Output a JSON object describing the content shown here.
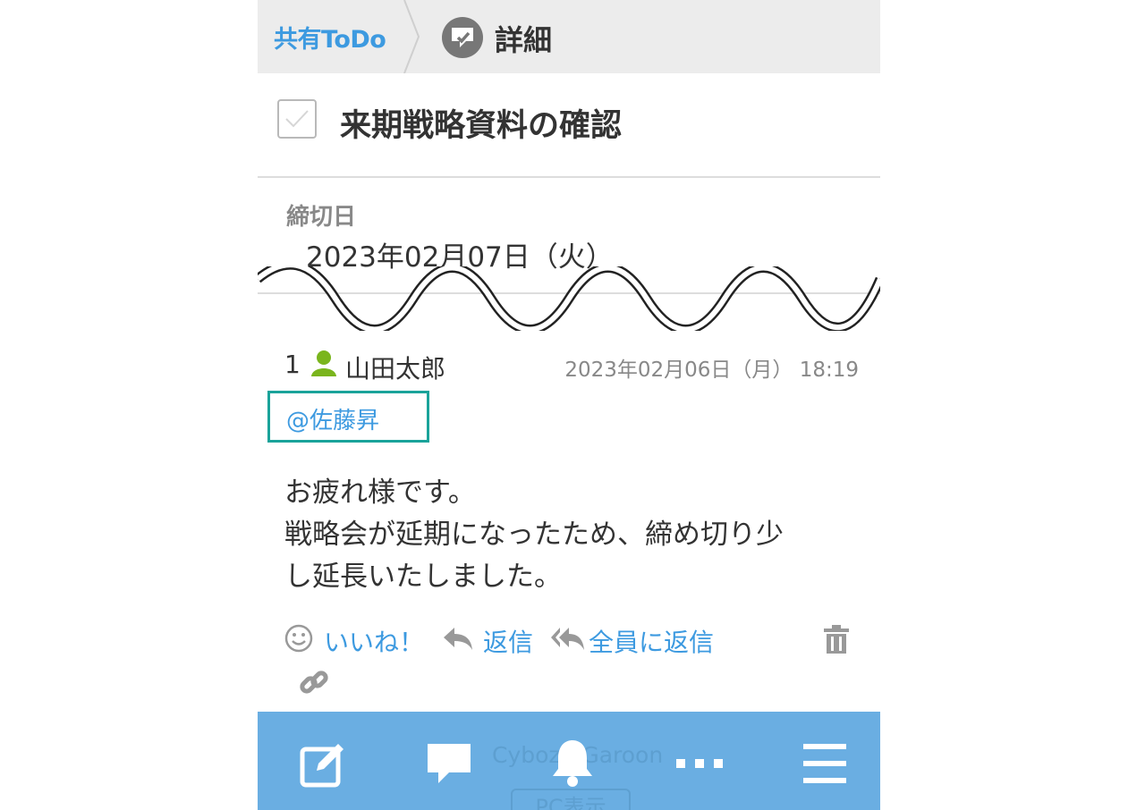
{
  "breadcrumb": {
    "parent_label": "共有ToDo",
    "current_label": "詳細"
  },
  "todo": {
    "title": "来期戦略資料の確認",
    "completed": false,
    "due_label": "締切日",
    "due_value": "2023年02月07日（火）"
  },
  "comment": {
    "number": "1",
    "author": "山田太郎",
    "timestamp": "2023年02月06日（月） 18:19",
    "mention": "@佐藤昇",
    "body_lines": [
      "お疲れ様です。",
      "戦略会が延期になったため、締め切り少",
      "し延長いたしました。"
    ],
    "actions": {
      "like": "いいね！",
      "reply": "返信",
      "reply_all": "全員に返信"
    }
  },
  "footer": {
    "app_name": "Cybozu Garoon",
    "pc_view": "PC表示"
  },
  "toolbar": {
    "items": [
      "edit-icon",
      "comment-icon",
      "bell-icon",
      "more-icon",
      "menu-icon"
    ]
  },
  "colors": {
    "link": "#3d9ae0",
    "toolbar": "#6aaee2",
    "highlight": "#1aa39a",
    "user_icon": "#7ab51d"
  }
}
